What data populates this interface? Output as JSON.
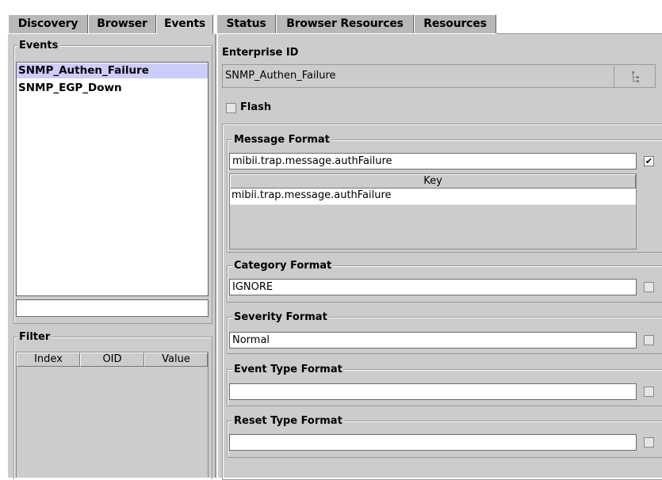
{
  "tabs": [
    "Discovery",
    "Browser",
    "Events",
    "Status",
    "Browser Resources",
    "Resources"
  ],
  "selected_tab": "Events",
  "events_panel": {
    "title": "Events",
    "items": [
      "SNMP_Authen_Failure",
      "SNMP_EGP_Down"
    ],
    "selected_index": 0,
    "filter_input_value": ""
  },
  "filter_panel": {
    "title": "Filter",
    "columns": [
      "Index",
      "OID",
      "Value"
    ]
  },
  "enterprise": {
    "label": "Enterprise ID",
    "value": "SNMP_Authen_Failure",
    "button_icon": "tree-icon"
  },
  "flash": {
    "label": "Flash",
    "checked": false
  },
  "message_format": {
    "title": "Message Format",
    "value": "mibii.trap.message.authFailure",
    "checked": true,
    "table_header": "Key",
    "table_rows": [
      "mibii.trap.message.authFailure"
    ]
  },
  "category_format": {
    "title": "Category Format",
    "value": "IGNORE",
    "checked": false
  },
  "severity_format": {
    "title": "Severity Format",
    "value": "Normal",
    "checked": false
  },
  "event_type_format": {
    "title": "Event Type Format",
    "value": "",
    "checked": false
  },
  "reset_type_format": {
    "title": "Reset Type Format",
    "value": "",
    "checked": false
  },
  "colors": {
    "panel": "#cccccc",
    "selection": "#ccccff",
    "tab": "#b8b8b8"
  }
}
